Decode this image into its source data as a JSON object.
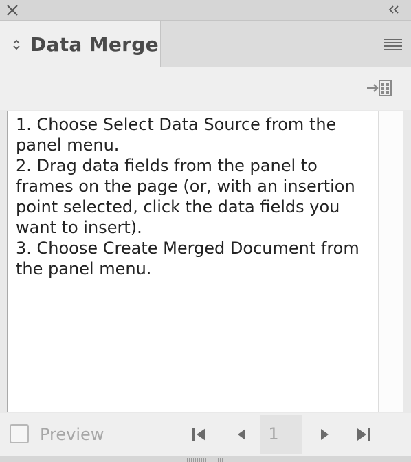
{
  "panel": {
    "title": "Data Merge"
  },
  "icons": {
    "close": "close-icon",
    "collapse": "double-chevron-left-icon",
    "tab_arrows": "up-down-arrows-icon",
    "panel_menu": "hamburger-menu-icon",
    "import": "import-data-source-icon",
    "first": "first-record-icon",
    "previous": "previous-record-icon",
    "next": "next-record-icon",
    "last": "last-record-icon"
  },
  "instructions": {
    "step1": "1. Choose Select Data Source from the panel menu.",
    "step2": "2. Drag data fields from the panel to frames on the page (or, with an insertion point selected, click the data fields you want to insert).",
    "step3": "3. Choose Create Merged Document from the panel menu."
  },
  "footer": {
    "preview_label": "Preview",
    "preview_checked": false,
    "record_number": "1"
  },
  "colors": {
    "panel_bg": "#efefef",
    "titlebar_bg": "#d6d6d6",
    "disabled_text": "#a6a6a6",
    "icon_color": "#6b6b6b"
  }
}
